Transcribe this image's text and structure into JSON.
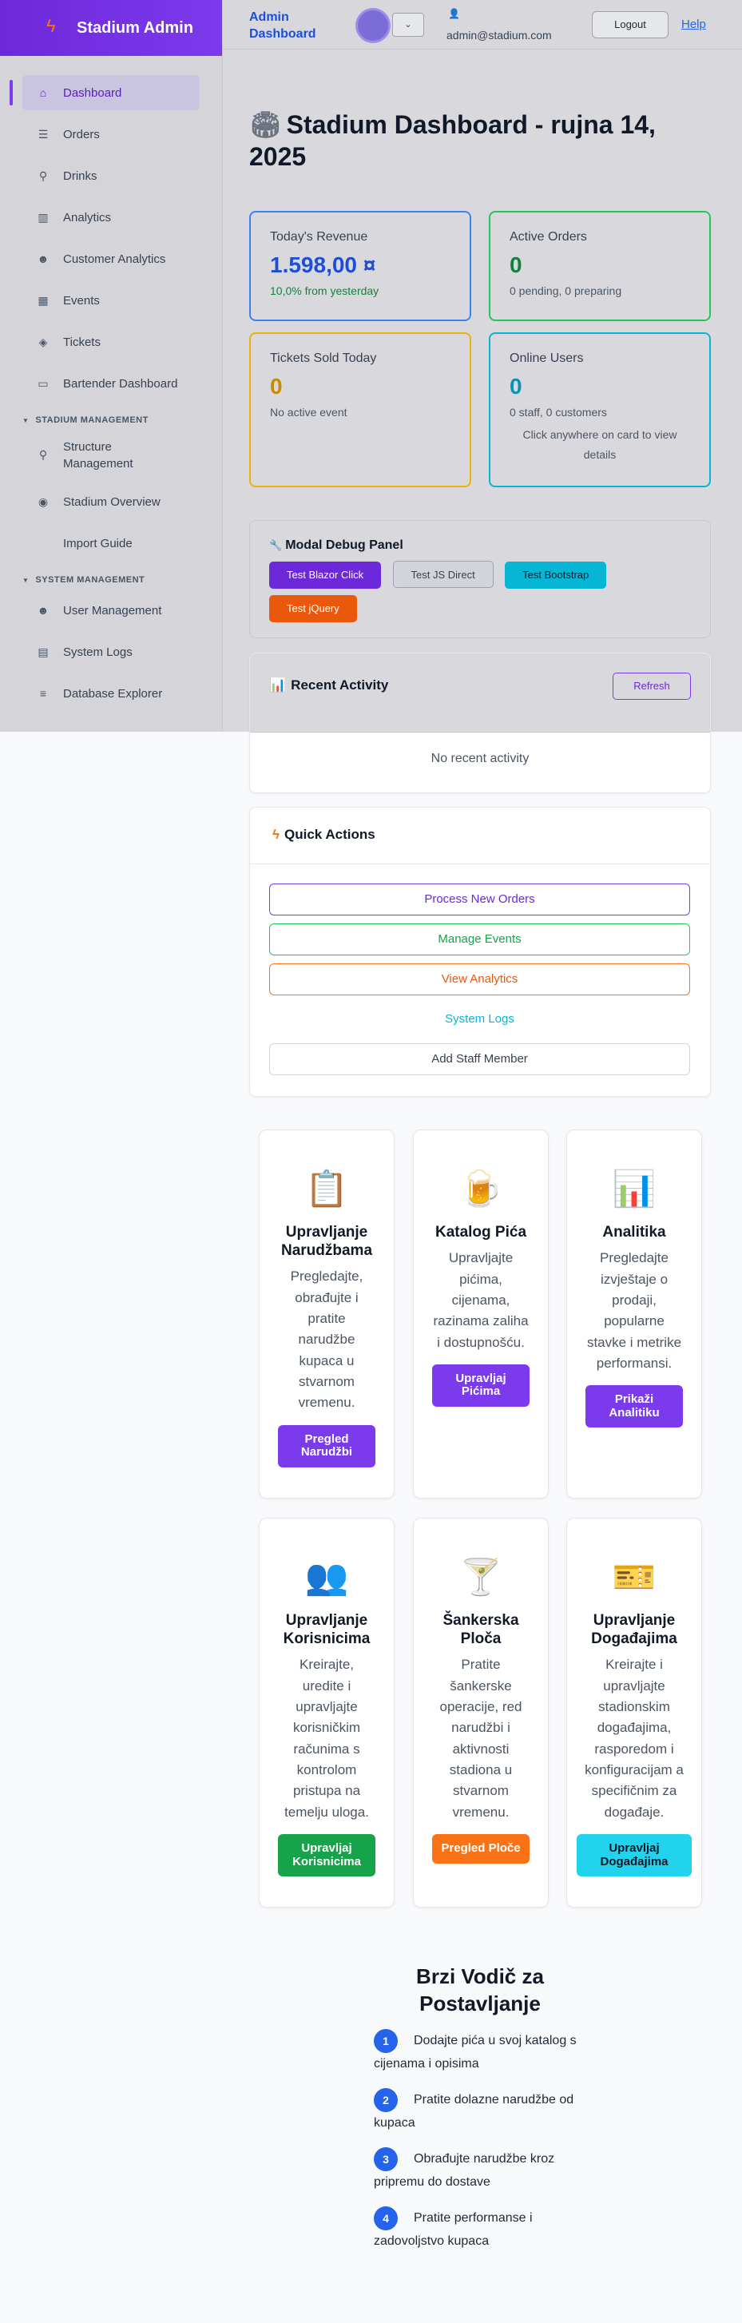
{
  "brand": {
    "title": "Stadium Admin",
    "icon": "lightning-bolt-icon"
  },
  "sidebar": {
    "items": [
      {
        "label": "Dashboard",
        "icon": "home-icon"
      },
      {
        "label": "Orders",
        "icon": "list-icon"
      },
      {
        "label": "Drinks",
        "icon": "drinks-icon"
      },
      {
        "label": "Analytics",
        "icon": "chart-icon"
      },
      {
        "label": "Customer Analytics",
        "icon": "users-icon"
      },
      {
        "label": "Events",
        "icon": "calendar-icon"
      },
      {
        "label": "Tickets",
        "icon": "tag-icon"
      },
      {
        "label": "Bartender Dashboard",
        "icon": "monitor-icon"
      }
    ],
    "stadium_section": "STADIUM MANAGEMENT",
    "stadium_items": [
      {
        "label": "Structure Management",
        "icon": "map-pin-icon"
      },
      {
        "label": "Stadium Overview",
        "icon": "eye-icon"
      },
      {
        "label": "Import Guide",
        "icon": ""
      }
    ],
    "system_section": "SYSTEM MANAGEMENT",
    "system_items": [
      {
        "label": "User Management",
        "icon": "users-icon"
      },
      {
        "label": "System Logs",
        "icon": "file-icon"
      },
      {
        "label": "Database Explorer",
        "icon": "database-icon"
      }
    ]
  },
  "topbar": {
    "title": "Admin Dashboard",
    "user_email": "admin@stadium.com",
    "logout_label": "Logout",
    "help_label": "Help"
  },
  "page": {
    "title": "Stadium Dashboard - rujna 14, 2025"
  },
  "stats": {
    "revenue": {
      "label": "Today's Revenue",
      "value": "1.598,00 ¤",
      "sub": "10,0% from yesterday"
    },
    "orders": {
      "label": "Active Orders",
      "value": "0",
      "sub": "0 pending, 0 preparing"
    },
    "tickets": {
      "label": "Tickets Sold Today",
      "value": "0",
      "sub": "No active event"
    },
    "online": {
      "label": "Online Users",
      "value": "0",
      "sub": "0 staff, 0 customers",
      "hint": "Click anywhere on card to view details"
    }
  },
  "debug": {
    "title": "Modal Debug Panel",
    "buttons": [
      "Test Blazor Click",
      "Test JS Direct",
      "Test Bootstrap",
      "Test jQuery"
    ]
  },
  "activity": {
    "title": "Recent Activity",
    "refresh_label": "Refresh",
    "empty": "No recent activity"
  },
  "quick_actions": {
    "title": "Quick Actions",
    "buttons": [
      "Process New Orders",
      "Manage Events",
      "View Analytics",
      "System Logs",
      "Add Staff Member"
    ]
  },
  "cards": [
    {
      "title": "Upravljanje Narudžbama",
      "desc": "Pregledajte, obrađujte i pratite narudžbe kupaca u stvarnom vremenu.",
      "button": "Pregled Narudžbi",
      "emoji": "📋",
      "color": "#7c3aed"
    },
    {
      "title": "Katalog Pića",
      "desc": "Upravljajte pićima, cijenama, razinama zaliha i dostupnošću.",
      "button": "Upravljaj Pićima",
      "emoji": "🍺",
      "color": "#7c3aed"
    },
    {
      "title": "Analitika",
      "desc": "Pregledajte izvještaje o prodaji, popularne stavke i metrike performansi.",
      "button": "Prikaži Analitiku",
      "emoji": "📊",
      "color": "#7c3aed"
    },
    {
      "title": "Upravljanje Korisnicima",
      "desc": "Kreirajte, uredite i upravljajte korisničkim računima s kontrolom pristupa na temelju uloga.",
      "button": "Upravljaj Korisnicima",
      "emoji": "👥",
      "color": "#16a34a"
    },
    {
      "title": "Šankerska Ploča",
      "desc": "Pratite šankerske operacije, red narudžbi i aktivnosti stadiona u stvarnom vremenu.",
      "button": "Pregled Ploče",
      "emoji": "🍸",
      "color": "#f97316"
    },
    {
      "title": "Upravljanje Događajima",
      "desc": "Kreirajte i upravljajte stadionskim događajima, rasporedom i konfiguracijam a specifičnim za događaje.",
      "button": "Upravljaj Događajima",
      "emoji": "🎫",
      "color": "#06b6d4"
    }
  ],
  "guide": {
    "title": "Brzi Vodič za Postavljanje",
    "steps": [
      {
        "num": "1",
        "text": "Dodajte pića u svoj katalog s cijenama i opisima"
      },
      {
        "num": "2",
        "text": "Pratite dolazne narudžbe od kupaca"
      },
      {
        "num": "3",
        "text": "Obrađujte narudžbe kroz pripremu do dostave"
      },
      {
        "num": "4",
        "text": "Pratite performanse i zadovoljstvo kupaca"
      }
    ]
  },
  "colors": {
    "accent": "#7c3aed",
    "blue": "#1d4ed8",
    "green": "#15803d",
    "yellow": "#ca8a04",
    "cyan": "#06b6d4",
    "orange": "#ea580c"
  }
}
